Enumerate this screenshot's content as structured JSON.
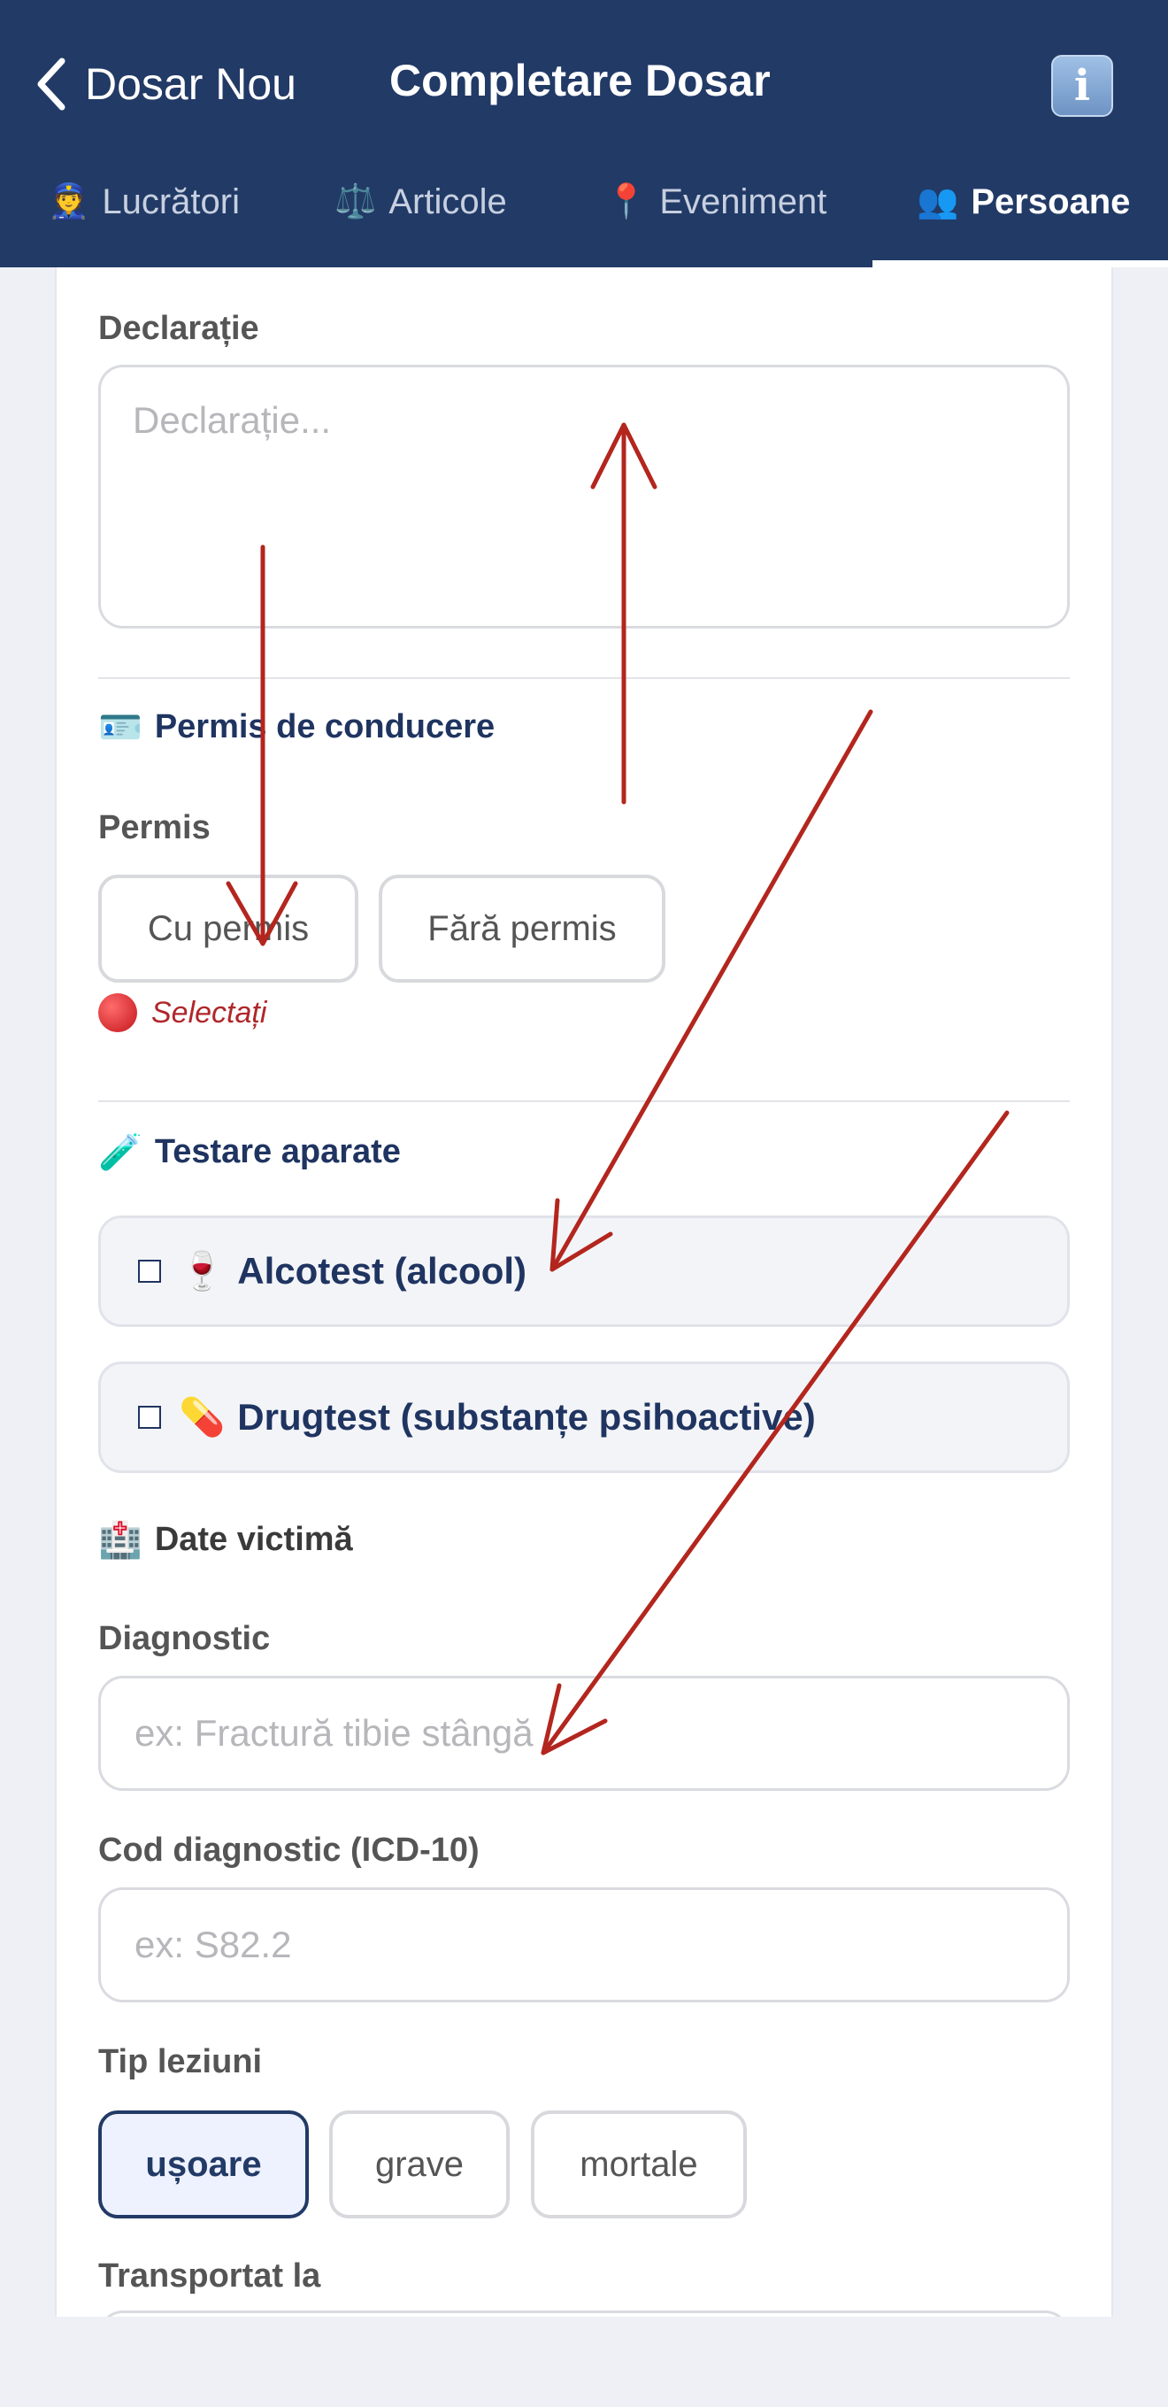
{
  "header": {
    "back_label": "Dosar Nou",
    "title": "Completare Dosar",
    "info_label": "i"
  },
  "tabs": [
    {
      "icon": "👮",
      "label": "Lucrători",
      "active": false
    },
    {
      "icon": "⚖️",
      "label": "Articole",
      "active": false
    },
    {
      "icon": "📍",
      "label": "Eveniment",
      "active": false
    },
    {
      "icon": "👥",
      "label": "Persoane",
      "active": true
    }
  ],
  "declaration": {
    "label": "Declarație",
    "placeholder": "Declarație..."
  },
  "license_section": {
    "icon": "🪪",
    "title": "Permis de conducere",
    "field_label": "Permis",
    "options": [
      "Cu permis",
      "Fără permis"
    ],
    "error": "Selectați"
  },
  "testing_section": {
    "icon": "🧪",
    "title": "Testare aparate",
    "items": [
      {
        "icon": "🍷",
        "label": "Alcotest (alcool)",
        "checked": false
      },
      {
        "icon": "💊",
        "label": "Drugtest (substanțe psihoactive)",
        "checked": false
      }
    ]
  },
  "victim_section": {
    "icon": "🏥",
    "title": "Date victimă",
    "diagnostic_label": "Diagnostic",
    "diagnostic_placeholder": "ex: Fractură tibie stângă",
    "code_label": "Cod diagnostic (ICD-10)",
    "code_placeholder": "ex: S82.2",
    "injury_label": "Tip leziuni",
    "injury_options": [
      "ușoare",
      "grave",
      "mortale"
    ],
    "injury_selected": "ușoare",
    "transport_label": "Transportat la"
  },
  "annotation_color": "#b3261e"
}
